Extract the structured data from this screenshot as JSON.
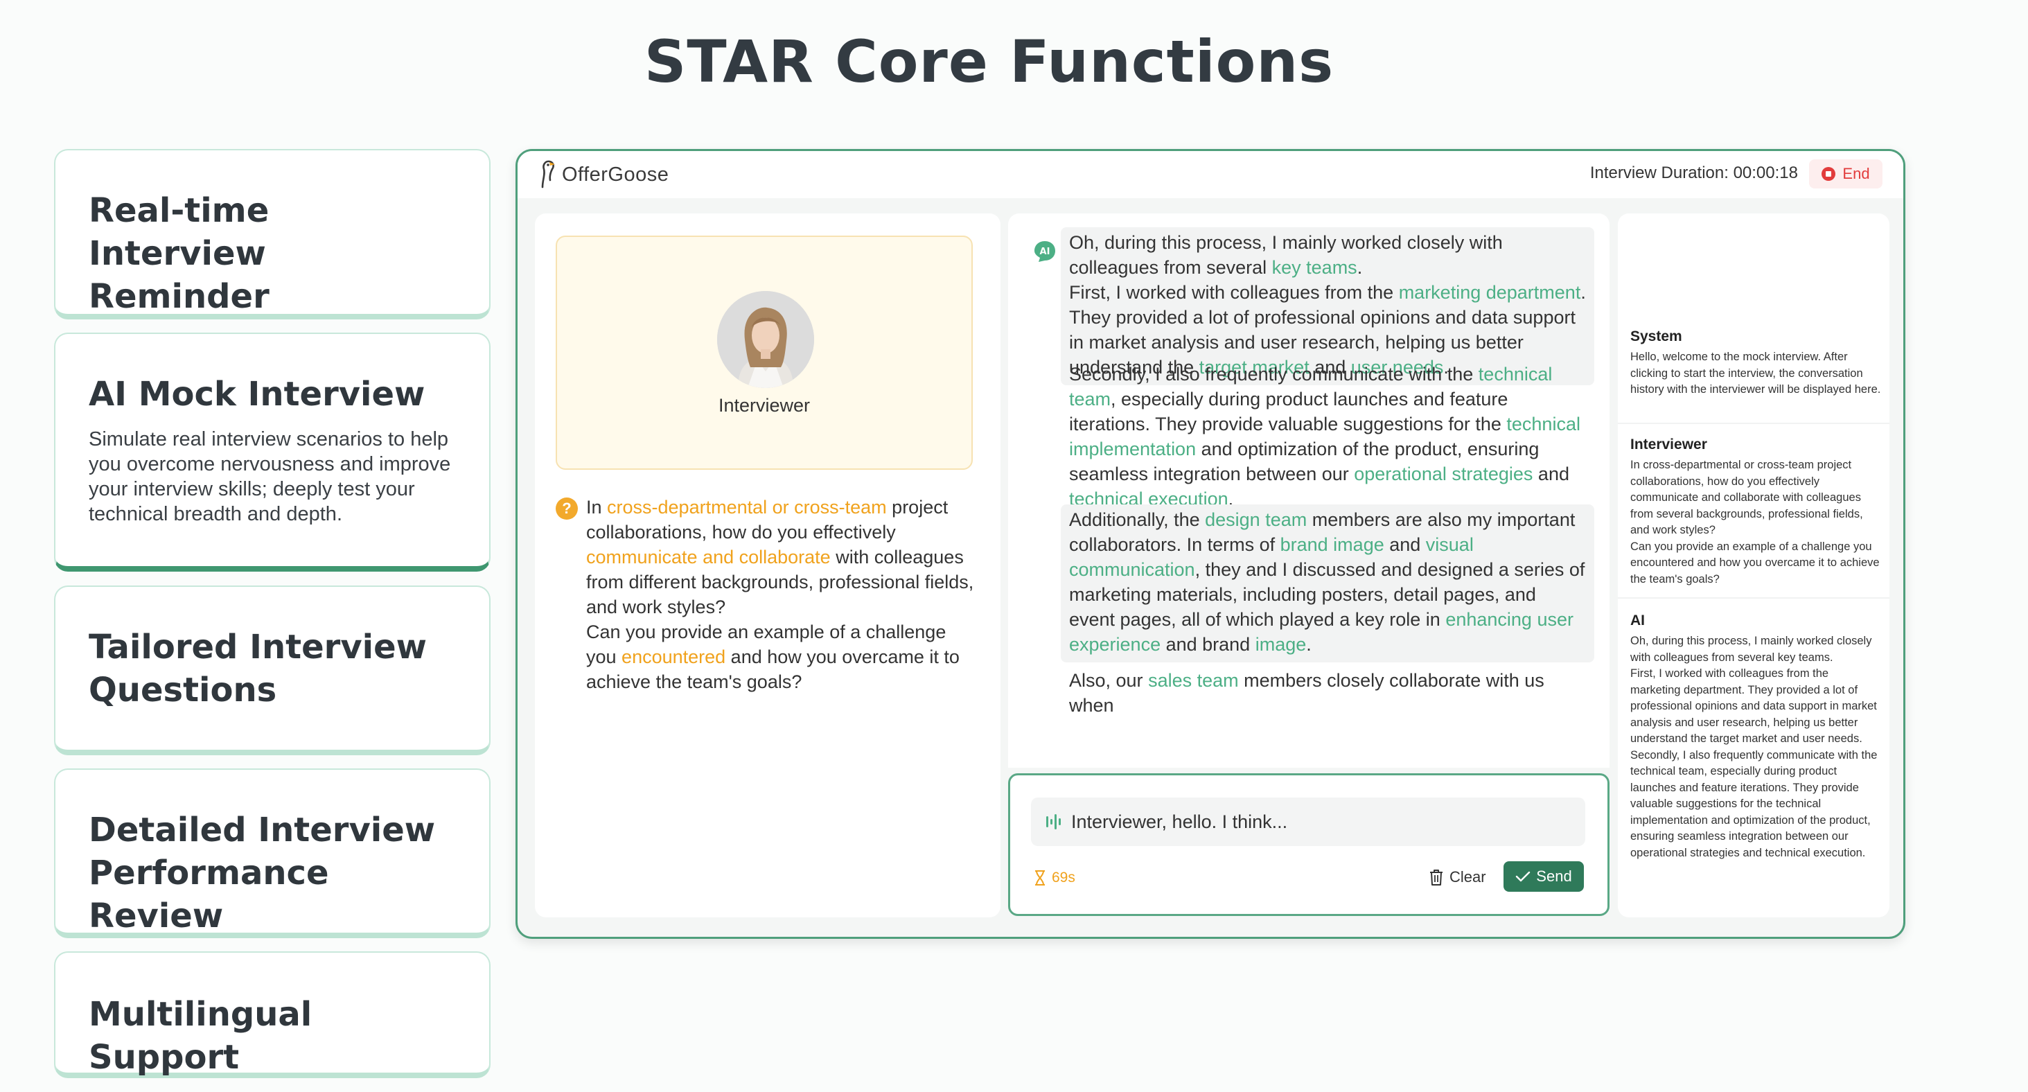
{
  "page": {
    "title": "STAR Core Functions"
  },
  "features": [
    {
      "title": "Real-time Interview Reminder",
      "desc": ""
    },
    {
      "title": "AI Mock Interview",
      "desc": "Simulate real interview scenarios to help you overcome nervousness and improve your interview skills; deeply test your technical breadth and depth."
    },
    {
      "title": "Tailored Interview Questions",
      "desc": ""
    },
    {
      "title": "Detailed Interview Performance Review",
      "desc": ""
    },
    {
      "title": "Multilingual Support",
      "desc": ""
    }
  ],
  "app": {
    "logo_text": "OfferGoose",
    "duration_label": "Interview Duration: 00:00:18",
    "end_label": "End",
    "interviewer_label": "Interviewer",
    "question": {
      "parts": [
        {
          "t": "In ",
          "hl": ""
        },
        {
          "t": "cross-departmental or cross-team",
          "hl": "orange"
        },
        {
          "t": " project collaborations, how do you effectively ",
          "hl": ""
        },
        {
          "t": "communicate and collaborate",
          "hl": "orange"
        },
        {
          "t": " with colleagues from different backgrounds, professional fields, and work styles?\nCan you provide an example of a challenge you ",
          "hl": ""
        },
        {
          "t": "encountered",
          "hl": "orange"
        },
        {
          "t": " and how you overcame it to achieve the team's goals?",
          "hl": ""
        }
      ]
    },
    "ai_badge": "AI",
    "answer_blocks": [
      {
        "shade": true,
        "parts": [
          {
            "t": "Oh, during this process, I mainly worked closely with colleagues from several ",
            "hl": ""
          },
          {
            "t": "key teams",
            "hl": "green"
          },
          {
            "t": ".\nFirst, I worked with colleagues from the ",
            "hl": ""
          },
          {
            "t": "marketing department",
            "hl": "green"
          },
          {
            "t": ". They provided a lot of professional opinions and data support in market analysis and user research, helping us better understand the ",
            "hl": ""
          },
          {
            "t": "target market",
            "hl": "green"
          },
          {
            "t": " and ",
            "hl": ""
          },
          {
            "t": "user needs",
            "hl": "green"
          },
          {
            "t": ".",
            "hl": ""
          }
        ]
      },
      {
        "shade": false,
        "parts": [
          {
            "t": "Secondly, I also frequently communicate with the ",
            "hl": ""
          },
          {
            "t": "technical team",
            "hl": "green"
          },
          {
            "t": ", especially during product launches and feature iterations. They provide valuable suggestions for the ",
            "hl": ""
          },
          {
            "t": "technical implementation",
            "hl": "green"
          },
          {
            "t": " and optimization of the product, ensuring seamless integration between our ",
            "hl": ""
          },
          {
            "t": "operational strategies",
            "hl": "green"
          },
          {
            "t": " and ",
            "hl": ""
          },
          {
            "t": "technical execution",
            "hl": "green"
          },
          {
            "t": ".",
            "hl": ""
          }
        ]
      },
      {
        "shade": true,
        "parts": [
          {
            "t": "Additionally, the ",
            "hl": ""
          },
          {
            "t": "design team",
            "hl": "green"
          },
          {
            "t": " members are also my important collaborators. In terms of ",
            "hl": ""
          },
          {
            "t": "brand image",
            "hl": "green"
          },
          {
            "t": " and ",
            "hl": ""
          },
          {
            "t": "visual communication",
            "hl": "green"
          },
          {
            "t": ", they and I discussed and designed a series of marketing materials, including posters, detail pages, and event pages, all of which played a key role in ",
            "hl": ""
          },
          {
            "t": "enhancing user experience",
            "hl": "green"
          },
          {
            "t": " and brand ",
            "hl": ""
          },
          {
            "t": "image",
            "hl": "green"
          },
          {
            "t": ".",
            "hl": ""
          }
        ]
      },
      {
        "shade": false,
        "parts": [
          {
            "t": "Also, our ",
            "hl": ""
          },
          {
            "t": "sales team",
            "hl": "green"
          },
          {
            "t": " members closely collaborate with us when",
            "hl": ""
          }
        ]
      }
    ],
    "input": {
      "value": "Interviewer, hello. I think..."
    },
    "timer": "69s",
    "clear_label": "Clear",
    "send_label": "Send",
    "history": [
      {
        "role": "System",
        "text": "Hello, welcome to the mock interview. After clicking to start the interview, the conversation history with the interviewer will be displayed here."
      },
      {
        "role": "Interviewer",
        "text": "In cross-departmental or cross-team project collaborations, how do you effectively communicate and collaborate with colleagues from several backgrounds, professional fields, and work styles?\nCan you provide an example of a challenge you encountered and how you overcame it to achieve the team's goals?"
      },
      {
        "role": "AI",
        "text": "Oh, during this process, I mainly worked closely with colleagues from several key teams.\nFirst, I worked with colleagues from the marketing department. They provided a lot of professional opinions and data support in market analysis and user research, helping us better understand the target market and user needs.\nSecondly, I also frequently communicate with the technical team, especially during product launches and feature iterations. They provide valuable suggestions for the technical implementation and optimization of the product, ensuring seamless integration between our operational strategies and technical execution."
      }
    ]
  },
  "colors": {
    "accent_green": "#2f7a5a",
    "highlight_green": "#4caf85",
    "highlight_orange": "#f0a21d",
    "end_red": "#e23c3c"
  }
}
